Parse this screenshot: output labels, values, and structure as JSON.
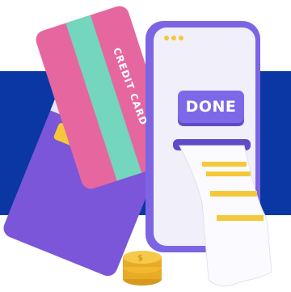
{
  "scene": {
    "credit_card_label": "CREDIT CARD",
    "button_label": "DONE"
  },
  "colors": {
    "band": "#0a37a3",
    "phone": "#7c64e3",
    "screen": "#f1effa",
    "pink_card": "#e6679f",
    "stripe": "#74d6bd",
    "purple_card": "#7b56d9",
    "chip": "#f5c83a",
    "receipt": "#fbfbff",
    "coin": "#f2b92f"
  }
}
